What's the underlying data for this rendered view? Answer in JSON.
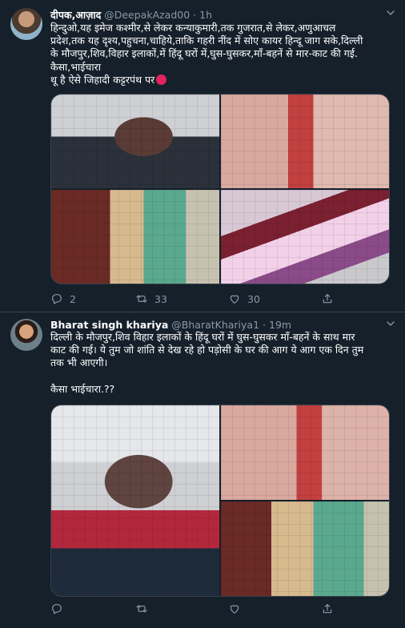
{
  "tweets": [
    {
      "name": "दीपक,आज़ाद",
      "handle": "@DeepakAzad00",
      "time": "1h",
      "text_lines": [
        "हिन्दुओ,यह इमेज कश्मीर,से लेकर कन्याकुमारी,तक गुजरात,से लेकर,अणुआचल",
        "प्रदेश,तक यह दृश्य,पहुचना,चाहिये,ताकि गहरी नींद में सोए कायर हिन्दू जाग सके,दिल्ली",
        "के मौजपुर,शिव,विहार इलाकों,में हिंदू घरों में,घुस-घुसकर,माँ-बहनें से मार-काट की गई.",
        "कैसा,भाईचारा",
        "थू है ऐसे जिहादी कट्टरपंथ पर"
      ],
      "replies": "2",
      "retweets": "33",
      "likes": "30"
    },
    {
      "name": "Bharat singh khariya",
      "handle": "@BharatKhariya1",
      "time": "19m",
      "text_lines": [
        "दिल्ली के मौजपुर,शिव विहार इलाकों के हिंदू घरों में घुस-घुसकर माँ-बहनें के साथ मार",
        "काट की गई। ये तुम जो शांति से देख रहे हो पड़ोसी के घर की आग ये आग एक दिन तुम",
        "तक भी आएगी।",
        "",
        "कैसा भाईचारा.??"
      ],
      "replies": "",
      "retweets": "",
      "likes": ""
    }
  ],
  "icons": {
    "reply": "reply-icon",
    "retweet": "retweet-icon",
    "like": "heart-icon",
    "share": "share-icon",
    "more": "chevron-down-icon"
  },
  "colors": {
    "background": "#15202b",
    "muted": "#8899a6",
    "divider": "#38444d"
  }
}
